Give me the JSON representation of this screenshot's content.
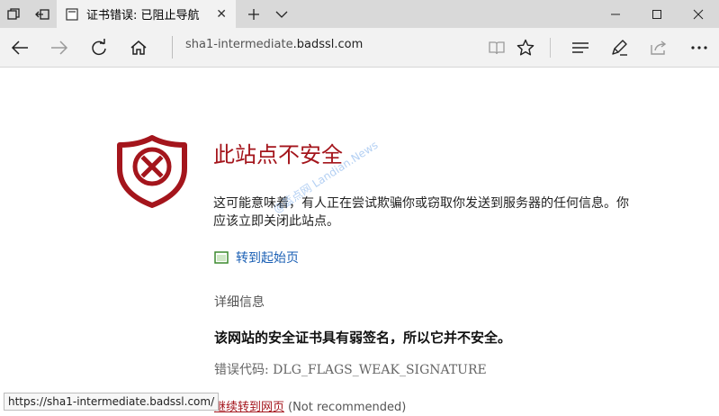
{
  "browser": {
    "tab": {
      "title": "证书错误: 已阻止导航"
    },
    "address": {
      "host": "sha1-intermediate",
      "domain": ".badssl.com"
    },
    "status_tip": "https://sha1-intermediate.badssl.com/"
  },
  "icons": {
    "tab_switcher": "tab-switcher-icon",
    "set_aside": "set-aside-tabs-icon",
    "warning": "warning-page-icon",
    "back": "back-arrow-icon",
    "forward": "forward-arrow-icon",
    "refresh": "refresh-icon",
    "home": "home-icon",
    "reading_view": "reading-view-icon",
    "favorites": "star-icon",
    "hub": "hub-icon",
    "notes": "pen-icon",
    "share": "share-icon",
    "more": "more-icon"
  },
  "page": {
    "title": "此站点不安全",
    "desc": "这可能意味着，有人正在尝试欺骗你或窃取你发送到服务器的任何信息。你应该立即关闭此站点。",
    "home_link": "转到起始页",
    "details_toggle": "详细信息",
    "reason": "该网站的安全证书具有弱签名，所以它并不安全。",
    "error_code": "错误代码: DLG_FLAGS_WEAK_SIGNATURE",
    "continue_link": "继续转到网页",
    "continue_note": "(Not recommended)"
  },
  "watermark": "@蓝点网 Landian.News",
  "colors": {
    "danger": "#a4151c",
    "link": "#1a5fb4",
    "chrome": "#f2f2f2",
    "titlebar": "#d9d9d9"
  }
}
